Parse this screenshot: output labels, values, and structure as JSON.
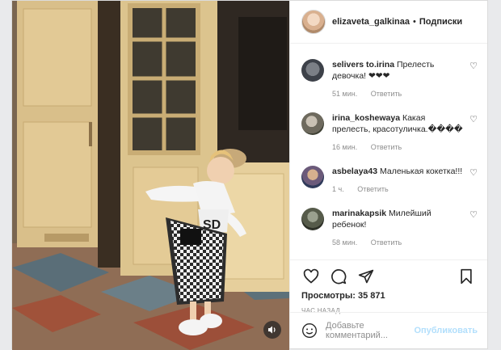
{
  "post": {
    "username": "elizaveta_galkinaa",
    "separator": "•",
    "follow_label": "Подписки",
    "views_label": "Просмотры:",
    "views_count": "35 871",
    "time_ago": "ЧАС НАЗАД"
  },
  "comments": [
    {
      "user": "selivers to.irina",
      "text": "Прелесть девочка! ❤❤❤",
      "time": "51 мин.",
      "reply": "Ответить"
    },
    {
      "user": "irina_koshewaya",
      "text": "Какая прелесть, красотуличка.����",
      "time": "16 мин.",
      "reply": "Ответить"
    },
    {
      "user": "asbelaya43",
      "text": "Маленькая кокетка!!!",
      "time": "1 ч.",
      "reply": "Ответить"
    },
    {
      "user": "marinakapsik",
      "text": "Милейший ребенок!",
      "time": "58 мин.",
      "reply": "Ответить"
    }
  ],
  "composer": {
    "placeholder": "Добавьте комментарий...",
    "post_label": "Опубликовать"
  },
  "icons": [
    "heart-icon",
    "comment-icon",
    "share-icon",
    "bookmark-icon",
    "emoji-icon",
    "sound-icon"
  ],
  "colors": {
    "link_disabled": "#b2dffc",
    "muted": "#8e8e8e",
    "text": "#262626"
  }
}
